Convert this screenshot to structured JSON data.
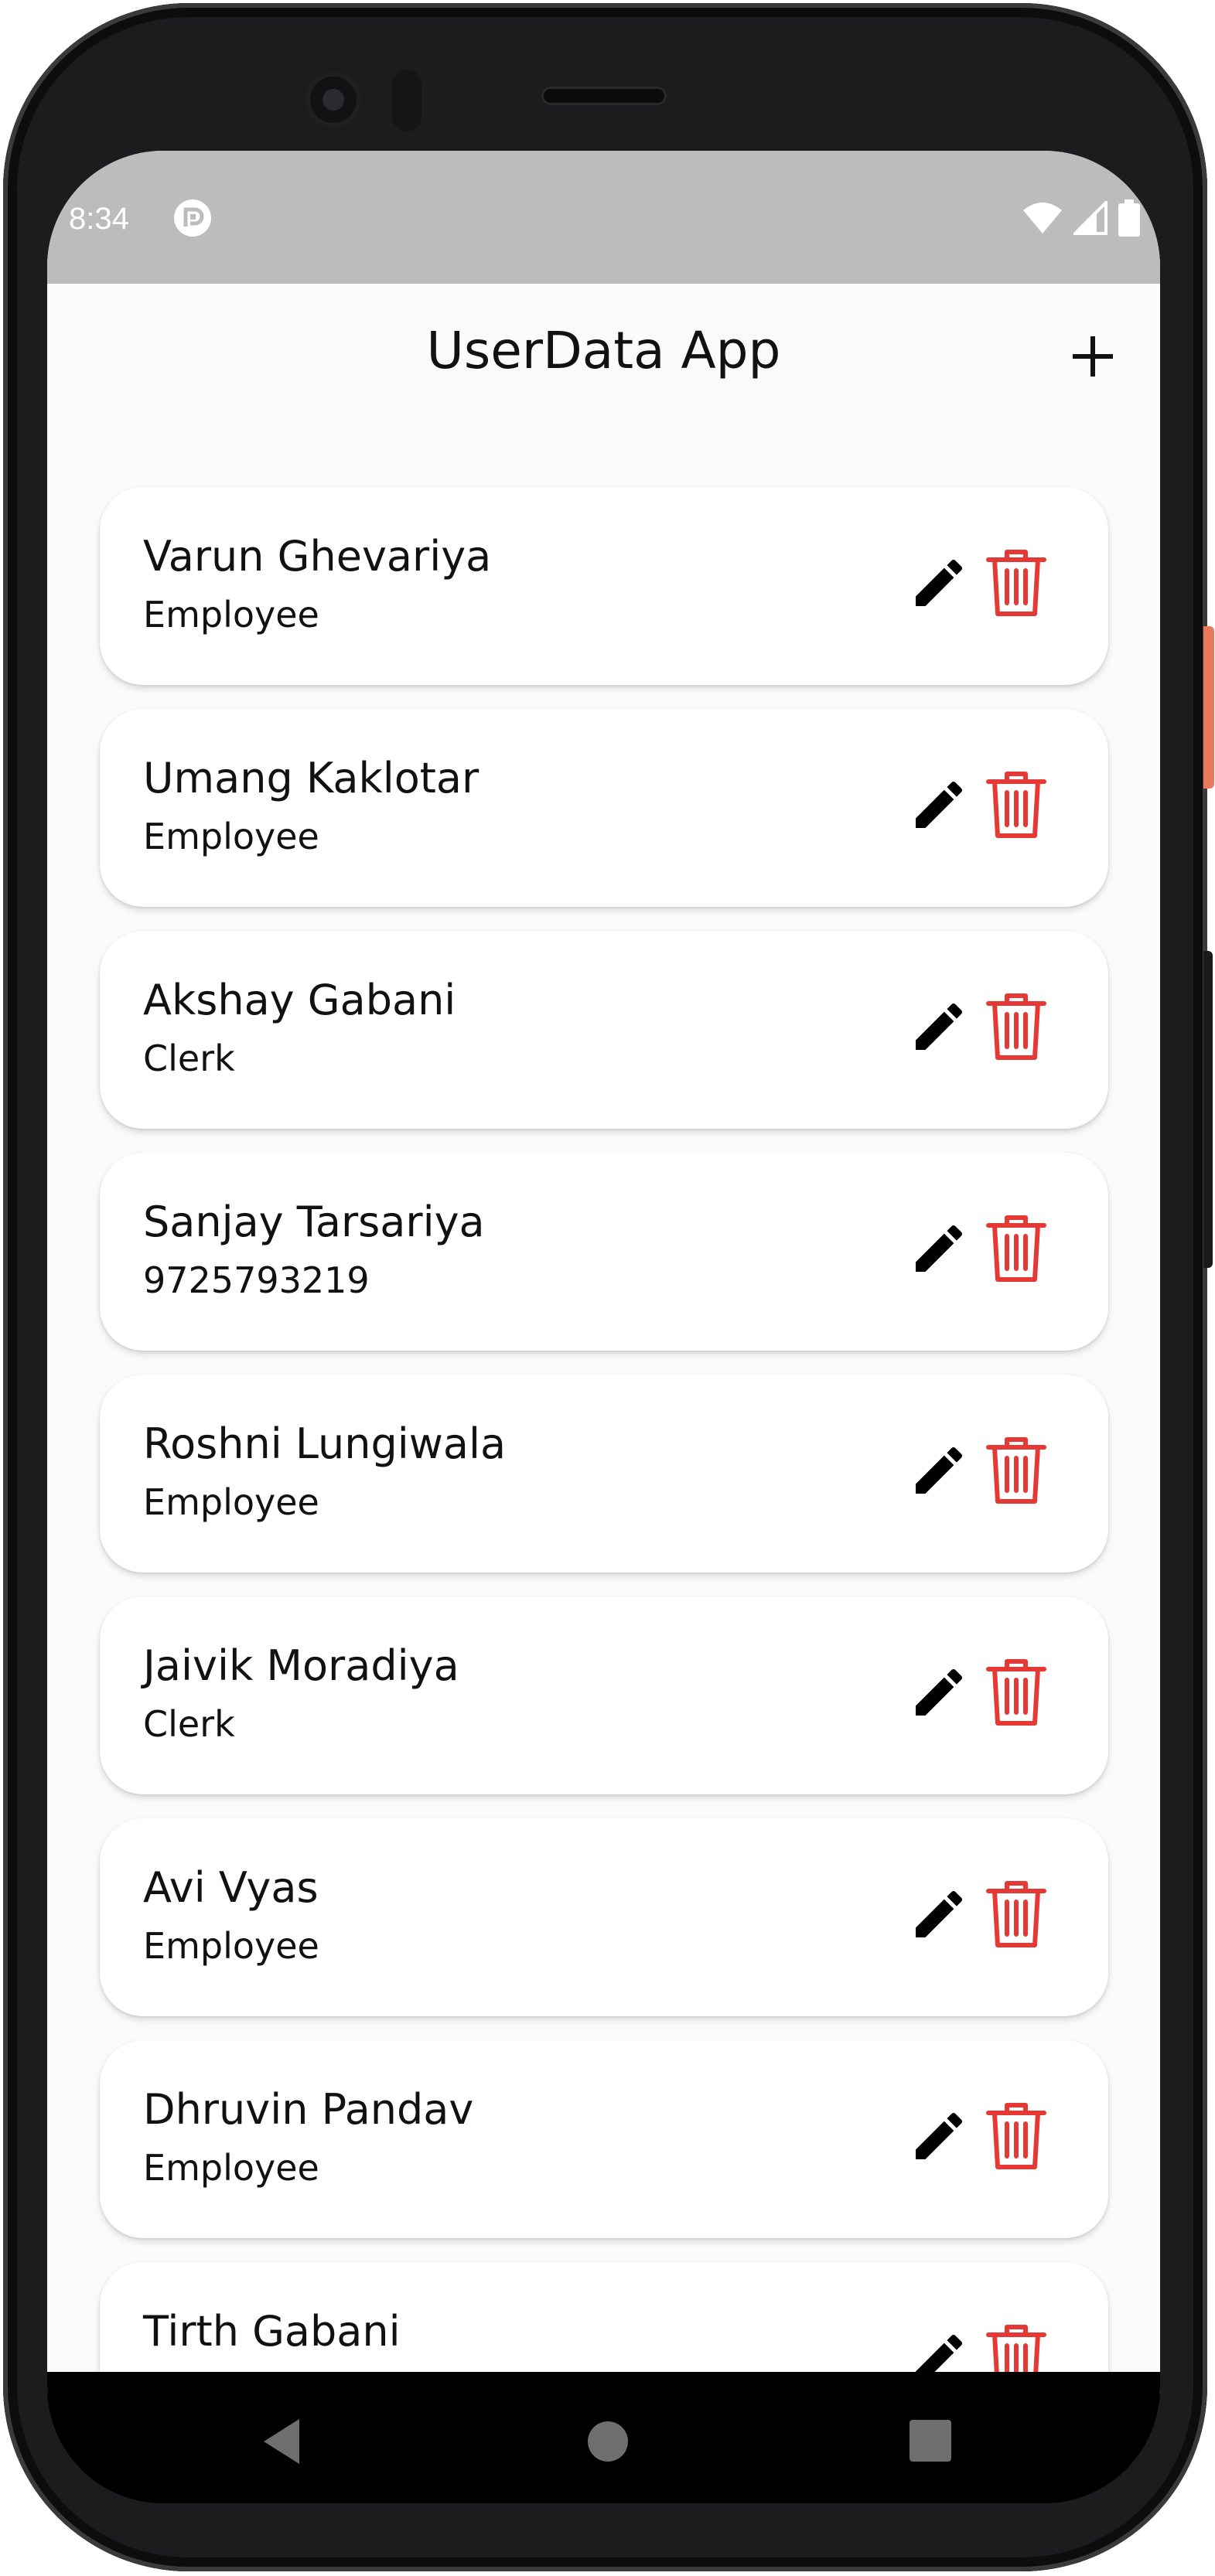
{
  "status_bar": {
    "time": "8:34"
  },
  "app_bar": {
    "title": "UserData App",
    "add_icon": "plus-icon"
  },
  "users": [
    {
      "name": "Varun Ghevariya",
      "subtitle": "Employee"
    },
    {
      "name": "Umang Kaklotar",
      "subtitle": "Employee"
    },
    {
      "name": "Akshay Gabani",
      "subtitle": "Clerk"
    },
    {
      "name": "Sanjay Tarsariya",
      "subtitle": "9725793219"
    },
    {
      "name": "Roshni Lungiwala",
      "subtitle": "Employee"
    },
    {
      "name": "Jaivik Moradiya",
      "subtitle": "Clerk"
    },
    {
      "name": "Avi Vyas",
      "subtitle": "Employee"
    },
    {
      "name": "Dhruvin Pandav",
      "subtitle": "Employee"
    },
    {
      "name": "Tirth Gabani",
      "subtitle": ""
    }
  ],
  "colors": {
    "delete_icon": "#e53935",
    "edit_icon": "#000000",
    "status_bar": "#bcbcbc",
    "background": "#fafafa",
    "card": "#ffffff"
  },
  "navigation": {
    "back_icon": "triangle-back-icon",
    "home_icon": "circle-home-icon",
    "recents_icon": "square-recents-icon"
  }
}
